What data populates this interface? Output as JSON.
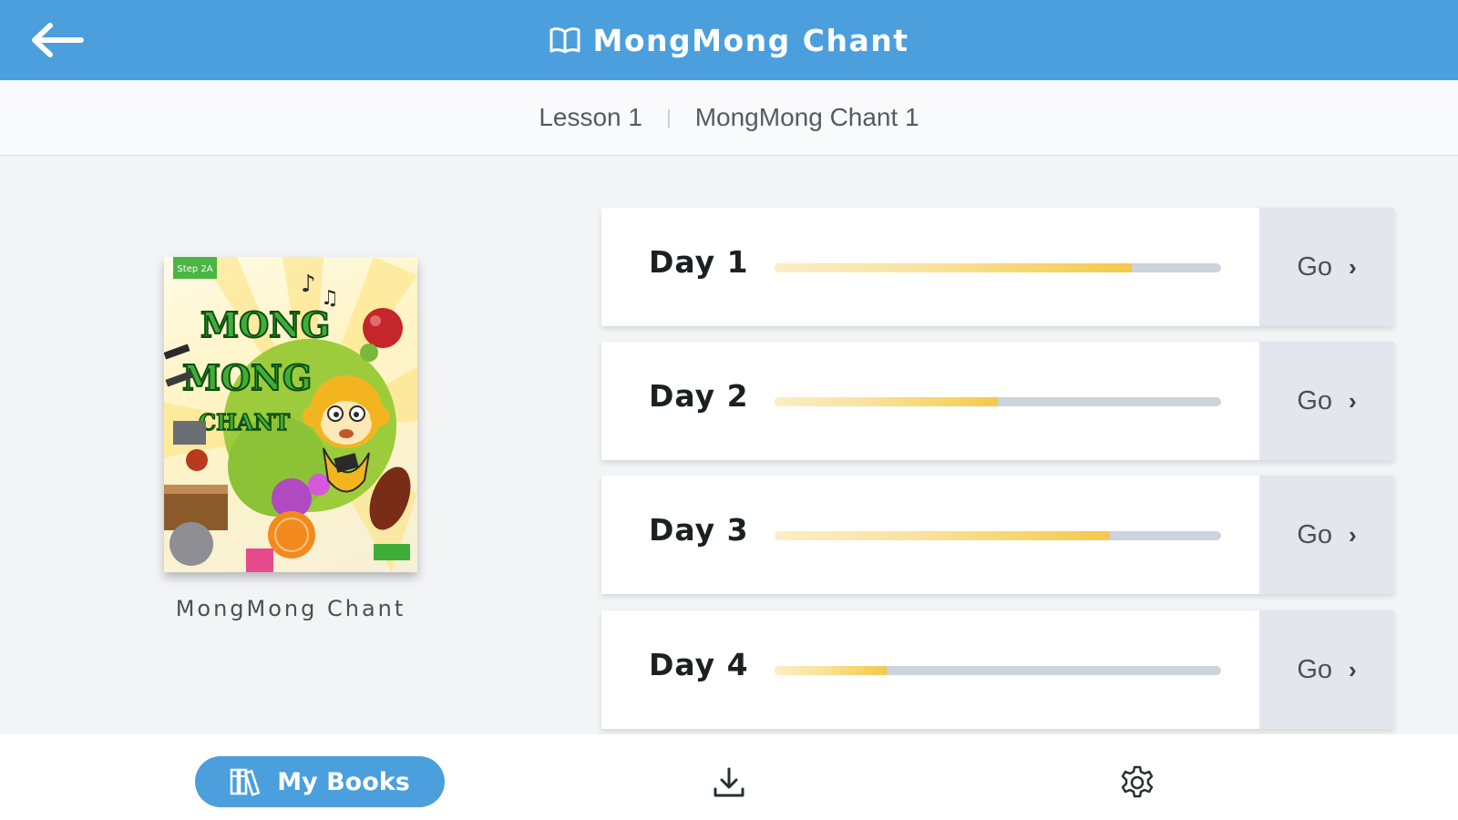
{
  "header": {
    "title": "MongMong Chant",
    "icon": "book-open-icon",
    "back_icon": "arrow-left-icon",
    "background": "#4a9fdc"
  },
  "breadcrumb": {
    "items": [
      "Lesson 1",
      "MongMong Chant 1"
    ],
    "separator": "|"
  },
  "book": {
    "title": "MongMong Chant",
    "cover_text": [
      "MONG",
      "MONG",
      "CHANT"
    ],
    "cover_badge": "Step 2A"
  },
  "days": [
    {
      "label": "Day 1",
      "progress": 0.8,
      "go_label": "Go",
      "go_icon": "chevron-right-icon"
    },
    {
      "label": "Day 2",
      "progress": 0.5,
      "go_label": "Go",
      "go_icon": "chevron-right-icon"
    },
    {
      "label": "Day 3",
      "progress": 0.75,
      "go_label": "Go",
      "go_icon": "chevron-right-icon"
    },
    {
      "label": "Day 4",
      "progress": 0.25,
      "go_label": "Go",
      "go_icon": "chevron-right-icon"
    }
  ],
  "bottom_nav": {
    "my_books_label": "My Books",
    "my_books_icon": "books-icon",
    "download_icon": "download-icon",
    "settings_icon": "gear-icon"
  },
  "colors": {
    "accent": "#4a9fdc",
    "progress_fill": "#f3c94a",
    "progress_track": "#cdd3dc"
  }
}
